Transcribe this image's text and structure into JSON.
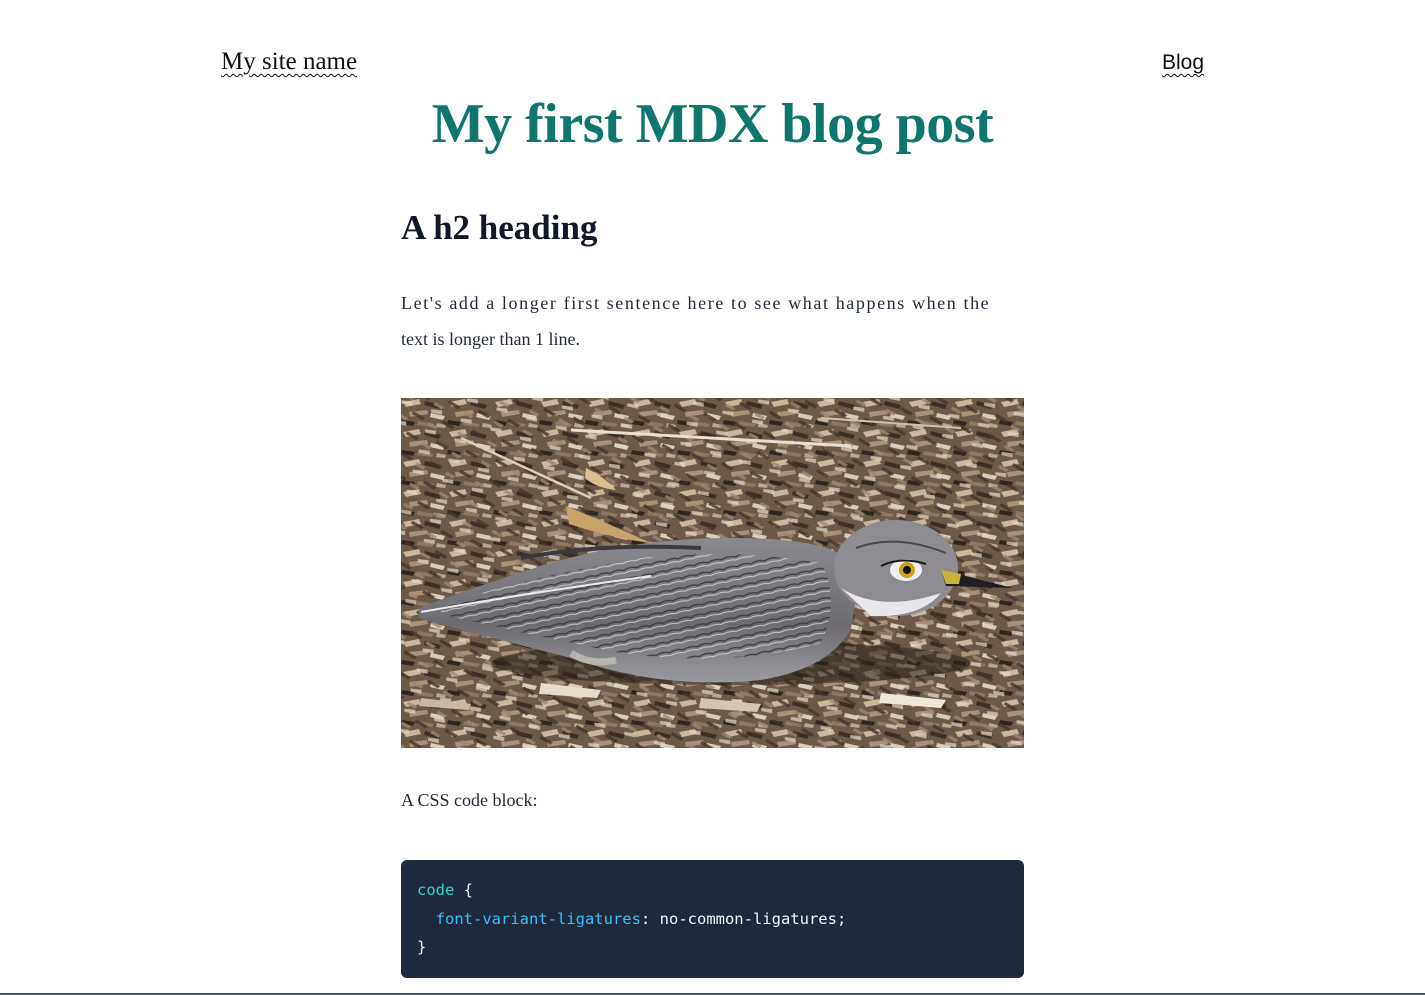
{
  "header": {
    "site_name": "My site name",
    "nav": {
      "blog_label": "Blog"
    }
  },
  "post": {
    "title": "My first MDX blog post",
    "h2": "A h2 heading",
    "paragraph_line1": "Let's add a longer first sentence here to see what happens when the",
    "paragraph_line2": "text is longer than 1 line.",
    "image": {
      "subject": "bird-photo"
    },
    "code_caption": "A CSS code block:",
    "code": {
      "selector": "code",
      "open_brace": " {",
      "property": "font-variant-ligatures",
      "colon": ": ",
      "value": "no-common-ligatures;",
      "close_brace": "}"
    }
  },
  "colors": {
    "title": "#0f766e",
    "code_background": "#1e293b",
    "code_selector": "#2dd4bf",
    "code_property": "#38bdf8"
  }
}
